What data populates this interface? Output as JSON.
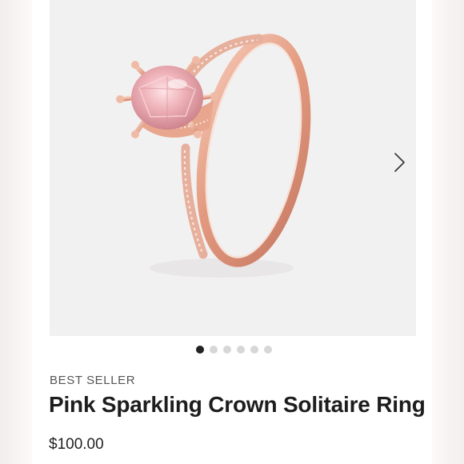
{
  "product": {
    "badge": "BEST SELLER",
    "title": "Pink Sparkling Crown Solitaire Ring",
    "price": "$100.00"
  },
  "gallery": {
    "image_subject": "rose-gold-ring-with-pink-stone",
    "next_icon": "chevron-right-icon",
    "total_images": 6,
    "active_index": 0
  },
  "colors": {
    "image_background": "#f2f1f1",
    "rose_gold": "#e6a58c",
    "pink_stone": "#e9a7ae",
    "dot_active": "#222222",
    "dot_inactive": "#d7d7d7"
  }
}
